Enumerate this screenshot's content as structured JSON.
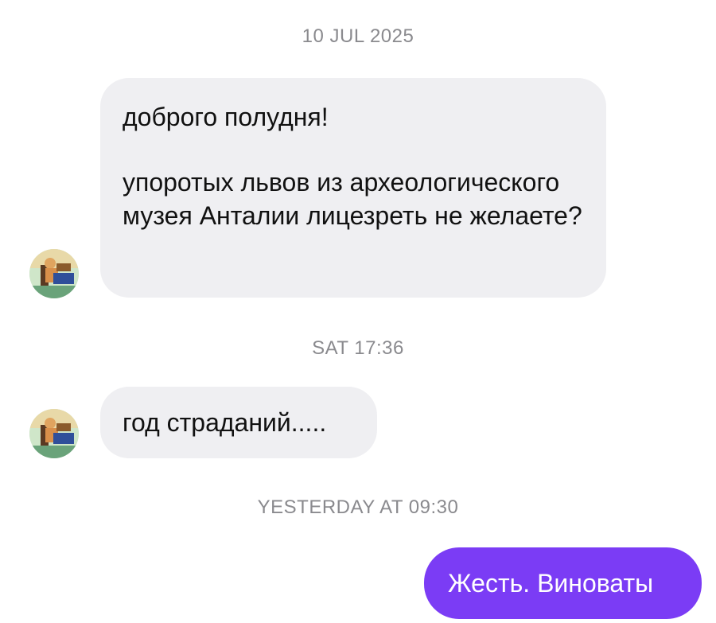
{
  "timestamps": {
    "first": "10 JUL 2025",
    "second": "SAT 17:36",
    "third": "YESTERDAY AT 09:30"
  },
  "messages": {
    "incoming": [
      {
        "paragraphs": [
          "доброго полудня!",
          "упоротых львов из археологического музея Анталии лицезреть не желаете?"
        ]
      },
      {
        "paragraphs": [
          "год страданий....."
        ]
      }
    ],
    "outgoing": [
      {
        "text": "Жесть. Виноваты"
      }
    ]
  },
  "avatar": {
    "icon": "contact-avatar-icon"
  },
  "colors": {
    "incoming_bubble": "#efeff2",
    "outgoing_bubble": "#7b3cf5",
    "timestamp": "#8a8a8e"
  }
}
